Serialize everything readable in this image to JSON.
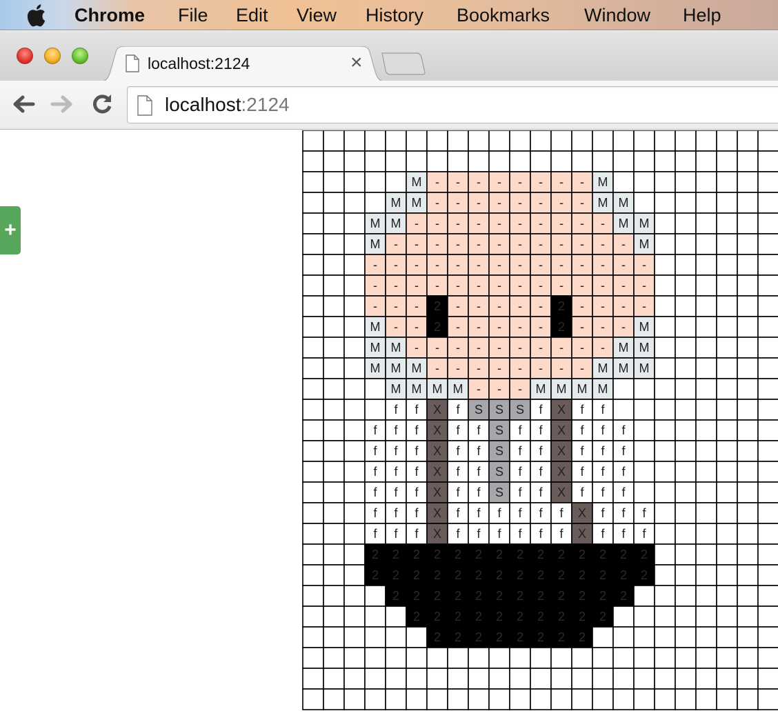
{
  "menubar": {
    "app_name": "Chrome",
    "items": [
      "File",
      "Edit",
      "View",
      "History",
      "Bookmarks",
      "Window",
      "Help"
    ]
  },
  "tab": {
    "title": "localhost:2124",
    "close_glyph": "×"
  },
  "toolbar": {
    "url_host": "localhost",
    "url_port": ":2124"
  },
  "page": {
    "add_button_glyph": "+"
  },
  "palette": {
    "-": "#fcd9c9",
    "M": "#e5eaec",
    "2": "#000000",
    "X": "#6b5c5c",
    "S": "#a7a7ab",
    "f": "#ffffff"
  },
  "pixel_grid": {
    "rows": [
      "                         ",
      "                         ",
      "     M--------M           ",
      "    MM--------MM          ",
      "   MM----------MM         ",
      "   M------------M         ",
      "   --------------         ",
      "   --------------         ",
      "   ---2-----2----         ",
      "   M--2-----2---M         ",
      "   MM----------MM         ",
      "   MMM--------MMM         ",
      "    MMMM---MMMM           ",
      "    ffXfSSSfXff           ",
      "   fffXffSffXfff          ",
      "   fffXffSffXfff          ",
      "   fffXffSffXfff          ",
      "   fffXffSffXfff          ",
      "   fffXffffffXfff         ",
      "   fffXffffffXfff         ",
      "   22222222222222         ",
      "   22222222222222         ",
      "    222222222222          ",
      "     2222222222           ",
      "      22222222            ",
      "                          ",
      "                          ",
      "                          "
    ]
  }
}
